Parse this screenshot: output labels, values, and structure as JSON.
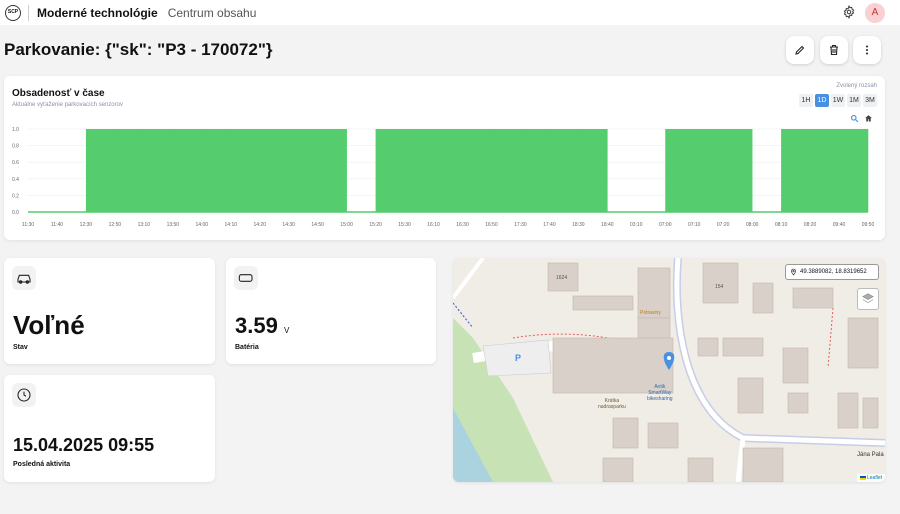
{
  "header": {
    "logo_text": "SCP",
    "brand": "Moderné technológie",
    "nav_link": "Centrum obsahu",
    "avatar_initial": "A"
  },
  "page": {
    "title": "Parkovanie: {\"sk\": \"P3 - 170072\"}"
  },
  "chart": {
    "title": "Obsadenosť v čase",
    "subtitle": "Aktuálne vyťaženie parkovacích senzorov",
    "range_label": "Zvolený rozsah",
    "ranges": [
      "1H",
      "1D",
      "1W",
      "1M",
      "3M"
    ],
    "active_range": "1D"
  },
  "chart_data": {
    "type": "area",
    "step": true,
    "color": "#55cc6e",
    "ylim": [
      0,
      1
    ],
    "yticks": [
      "1.0",
      "0.8",
      "0.6",
      "0.4",
      "0.2",
      "0.0"
    ],
    "x": [
      "11:30",
      "11:40",
      "12:30",
      "12:50",
      "13:10",
      "13:50",
      "14:00",
      "14:10",
      "14:20",
      "14:30",
      "14:50",
      "15:00",
      "15:20",
      "15:30",
      "16:10",
      "16:30",
      "16:50",
      "17:30",
      "17:40",
      "18:30",
      "18:40",
      "03:10",
      "07:00",
      "07:10",
      "07:20",
      "08:00",
      "08:10",
      "08:20",
      "09:40",
      "09:50"
    ],
    "values": [
      0,
      0,
      1,
      1,
      1,
      1,
      1,
      1,
      1,
      1,
      1,
      0,
      1,
      1,
      1,
      1,
      1,
      1,
      1,
      1,
      0,
      0,
      1,
      1,
      1,
      0,
      1,
      1,
      1,
      1
    ]
  },
  "stats": {
    "status_value": "Voľné",
    "status_label": "Stav",
    "battery_value": "3.59",
    "battery_unit": "V",
    "battery_label": "Batéria",
    "activity_value": "15.04.2025 09:55",
    "activity_label": "Posledná aktivita"
  },
  "map": {
    "coords": "49.3889082, 18.8319652",
    "labels": {
      "shop": "Potraviny",
      "post": "Krátka\nnadrasparku",
      "bike": "Antik\nSmartWay\nbikesharing",
      "street": "Jána Pala",
      "building1624": "1624",
      "building154": "154",
      "parking_p": "P"
    },
    "attribution": "Leaflet"
  }
}
